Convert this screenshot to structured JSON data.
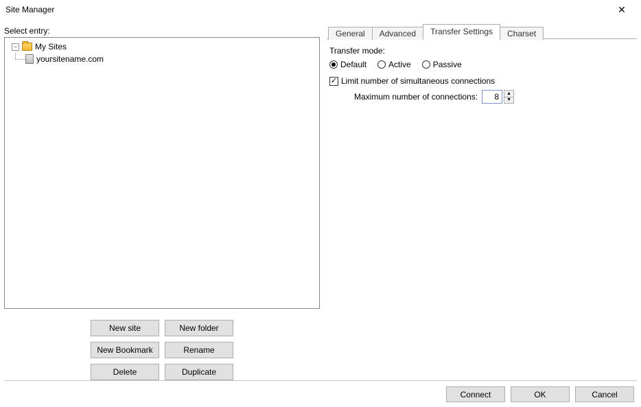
{
  "window": {
    "title": "Site Manager"
  },
  "left": {
    "select_entry_label": "Select entry:",
    "tree": {
      "root_label": "My Sites",
      "site_label": "yoursitename.com"
    },
    "buttons": {
      "new_site": "New site",
      "new_folder": "New folder",
      "new_bookmark": "New Bookmark",
      "rename": "Rename",
      "delete": "Delete",
      "duplicate": "Duplicate"
    }
  },
  "tabs": {
    "general": "General",
    "advanced": "Advanced",
    "transfer": "Transfer Settings",
    "charset": "Charset"
  },
  "transfer": {
    "mode_label": "Transfer mode:",
    "radios": {
      "default": "Default",
      "active": "Active",
      "passive": "Passive"
    },
    "selected_mode": "default",
    "limit_label": "Limit number of simultaneous connections",
    "limit_checked": true,
    "max_label": "Maximum number of connections:",
    "max_value": "8"
  },
  "footer": {
    "connect": "Connect",
    "ok": "OK",
    "cancel": "Cancel"
  }
}
